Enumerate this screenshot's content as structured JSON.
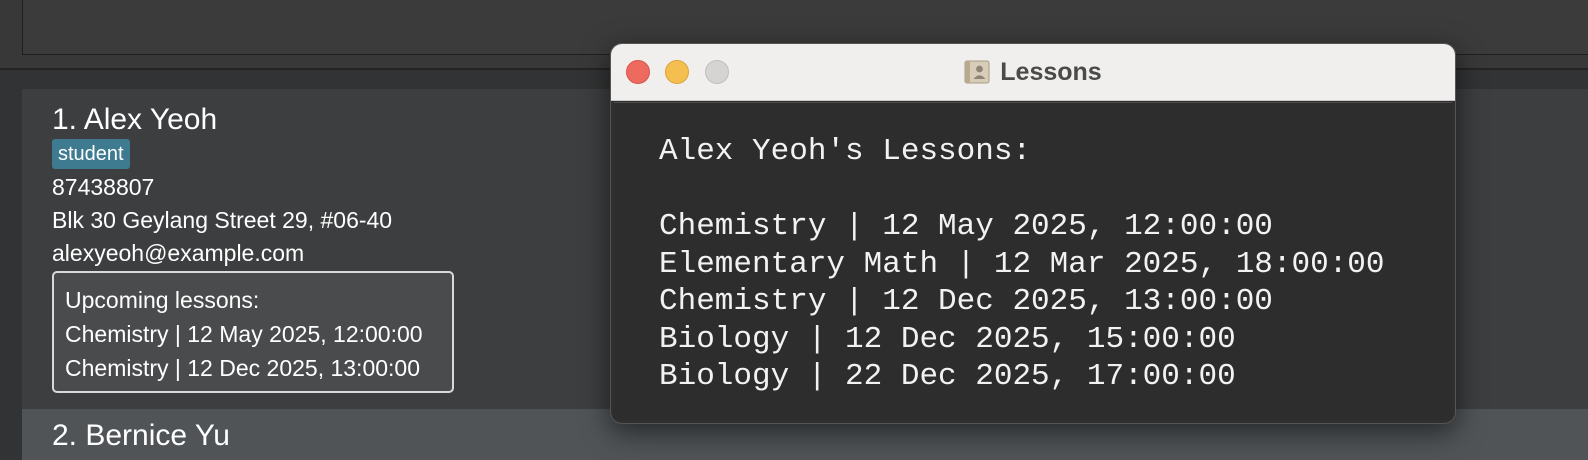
{
  "popup": {
    "title": "Lessons",
    "icon": "address-book-icon",
    "heading": "Alex Yeoh's Lessons:",
    "lessons": [
      "Chemistry | 12 May 2025, 12:00:00",
      "Elementary Math | 12 Mar 2025, 18:00:00",
      "Chemistry | 12 Dec 2025, 13:00:00",
      "Biology | 12 Dec 2025, 15:00:00",
      "Biology | 22 Dec 2025, 17:00:00"
    ]
  },
  "persons": [
    {
      "name": "1. Alex Yeoh",
      "tag": "student",
      "phone": "87438807",
      "address": "Blk 30 Geylang Street 29, #06-40",
      "email": "alexyeoh@example.com",
      "upcoming_title": "Upcoming lessons:",
      "upcoming": [
        "Chemistry | 12 May 2025, 12:00:00",
        "Chemistry | 12 Dec 2025, 13:00:00"
      ]
    },
    {
      "name": "2. Bernice Yu"
    }
  ],
  "colors": {
    "tag_bg": "#3e7b91",
    "close": "#ee6a5e",
    "minimize": "#f5bf4f",
    "zoom": "#d5d4d2"
  }
}
